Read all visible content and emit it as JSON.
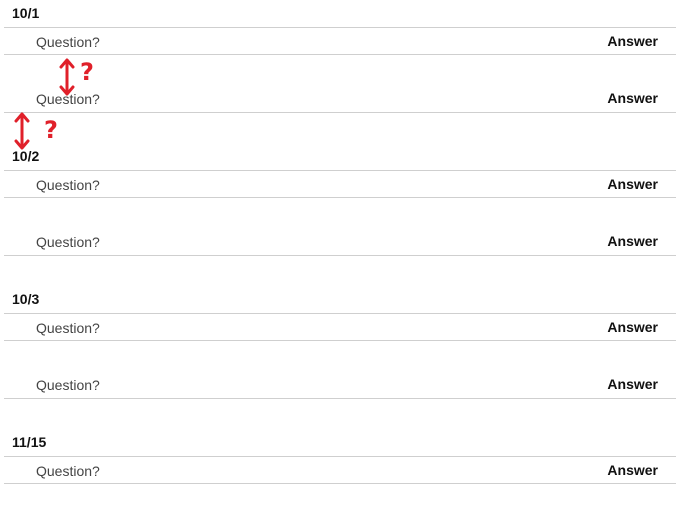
{
  "groups": [
    {
      "date": "10/1",
      "rows": [
        {
          "question": "Question?",
          "answer": "Answer"
        },
        {
          "question": "Question?",
          "answer": "Answer"
        }
      ]
    },
    {
      "date": "10/2",
      "rows": [
        {
          "question": "Question?",
          "answer": "Answer"
        },
        {
          "question": "Question?",
          "answer": "Answer"
        }
      ]
    },
    {
      "date": "10/3",
      "rows": [
        {
          "question": "Question?",
          "answer": "Answer"
        },
        {
          "question": "Question?",
          "answer": "Answer"
        }
      ]
    },
    {
      "date": "11/15",
      "rows": [
        {
          "question": "Question?",
          "answer": "Answer"
        }
      ]
    }
  ],
  "annotations": {
    "color": "#e0202a",
    "marks": [
      {
        "icon": "vertical-double-arrow-icon",
        "label": "?"
      },
      {
        "icon": "vertical-double-arrow-icon",
        "label": "?"
      }
    ]
  }
}
